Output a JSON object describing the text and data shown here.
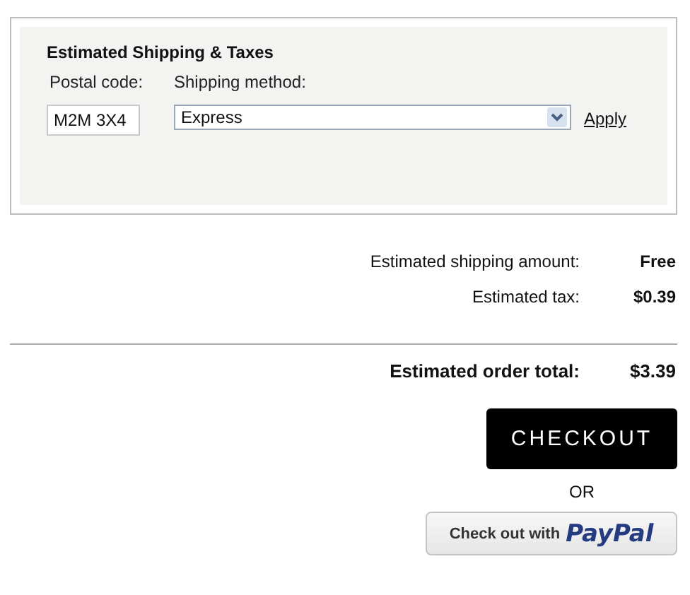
{
  "shipping_panel": {
    "title": "Estimated Shipping & Taxes",
    "postal_code_label": "Postal code:",
    "postal_code": "M2M 3X4",
    "shipping_method_label": "Shipping method:",
    "shipping_method": "Express",
    "apply_link": "Apply"
  },
  "summary": [
    {
      "label": "Estimated shipping amount:",
      "value": "Free"
    },
    {
      "label": "Estimated tax:",
      "value": "$0.39"
    }
  ],
  "total": {
    "label": "Estimated order total:",
    "value": "$3.39"
  },
  "checkout_button": "CHECKOUT",
  "or_text": "OR",
  "paypal_button": {
    "label": "Check out with",
    "logo": "PayPal"
  }
}
